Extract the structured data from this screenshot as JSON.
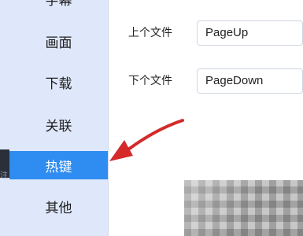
{
  "sidebar": {
    "items": [
      {
        "label": "字幕",
        "active": false
      },
      {
        "label": "画面",
        "active": false
      },
      {
        "label": "下载",
        "active": false
      },
      {
        "label": "关联",
        "active": false
      },
      {
        "label": "热键",
        "active": true
      },
      {
        "label": "其他",
        "active": false
      }
    ],
    "left_strip_text": "注"
  },
  "hotkeys": {
    "prev_file": {
      "label": "上个文件",
      "value": "PageUp"
    },
    "next_file": {
      "label": "下个文件",
      "value": "PageDown"
    }
  },
  "colors": {
    "sidebar_bg": "#dfe8fb",
    "active_bg": "#2f8cf0",
    "annotation_arrow": "#d42a2a"
  },
  "icons": {
    "annotation": "red-arrow-icon"
  }
}
